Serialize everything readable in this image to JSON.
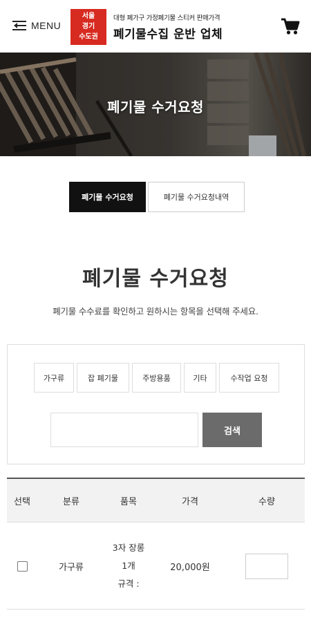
{
  "header": {
    "menu_label": "MENU",
    "badge_lines": [
      "서울",
      "경기",
      "수도권"
    ],
    "brand_subtitle": "대형 폐가구 가정폐기물 스티커 판매가격",
    "brand_title": "폐기물수집 운반 업체",
    "badge_color": "#d72a20"
  },
  "hero": {
    "title": "폐기물 수거요청"
  },
  "tabs": [
    {
      "label": "폐기물 수거요청",
      "active": true
    },
    {
      "label": "폐기물 수거요청내역",
      "active": false
    }
  ],
  "main": {
    "heading": "폐기물 수거요청",
    "description": "폐기물 수수료를 확인하고 원하시는 항목을 선택해 주세요."
  },
  "filter": {
    "categories": [
      "가구류",
      "잡 폐기물",
      "주방용품",
      "기타",
      "수작업 요청"
    ],
    "search_value": "",
    "search_button": "검색"
  },
  "table": {
    "headers": [
      "선택",
      "분류",
      "품목",
      "가격",
      "수량"
    ],
    "rows": [
      {
        "category": "가구류",
        "item_lines": [
          "3자 장롱",
          "1개",
          "규격 :"
        ],
        "price": "20,000원",
        "quantity": ""
      }
    ]
  }
}
